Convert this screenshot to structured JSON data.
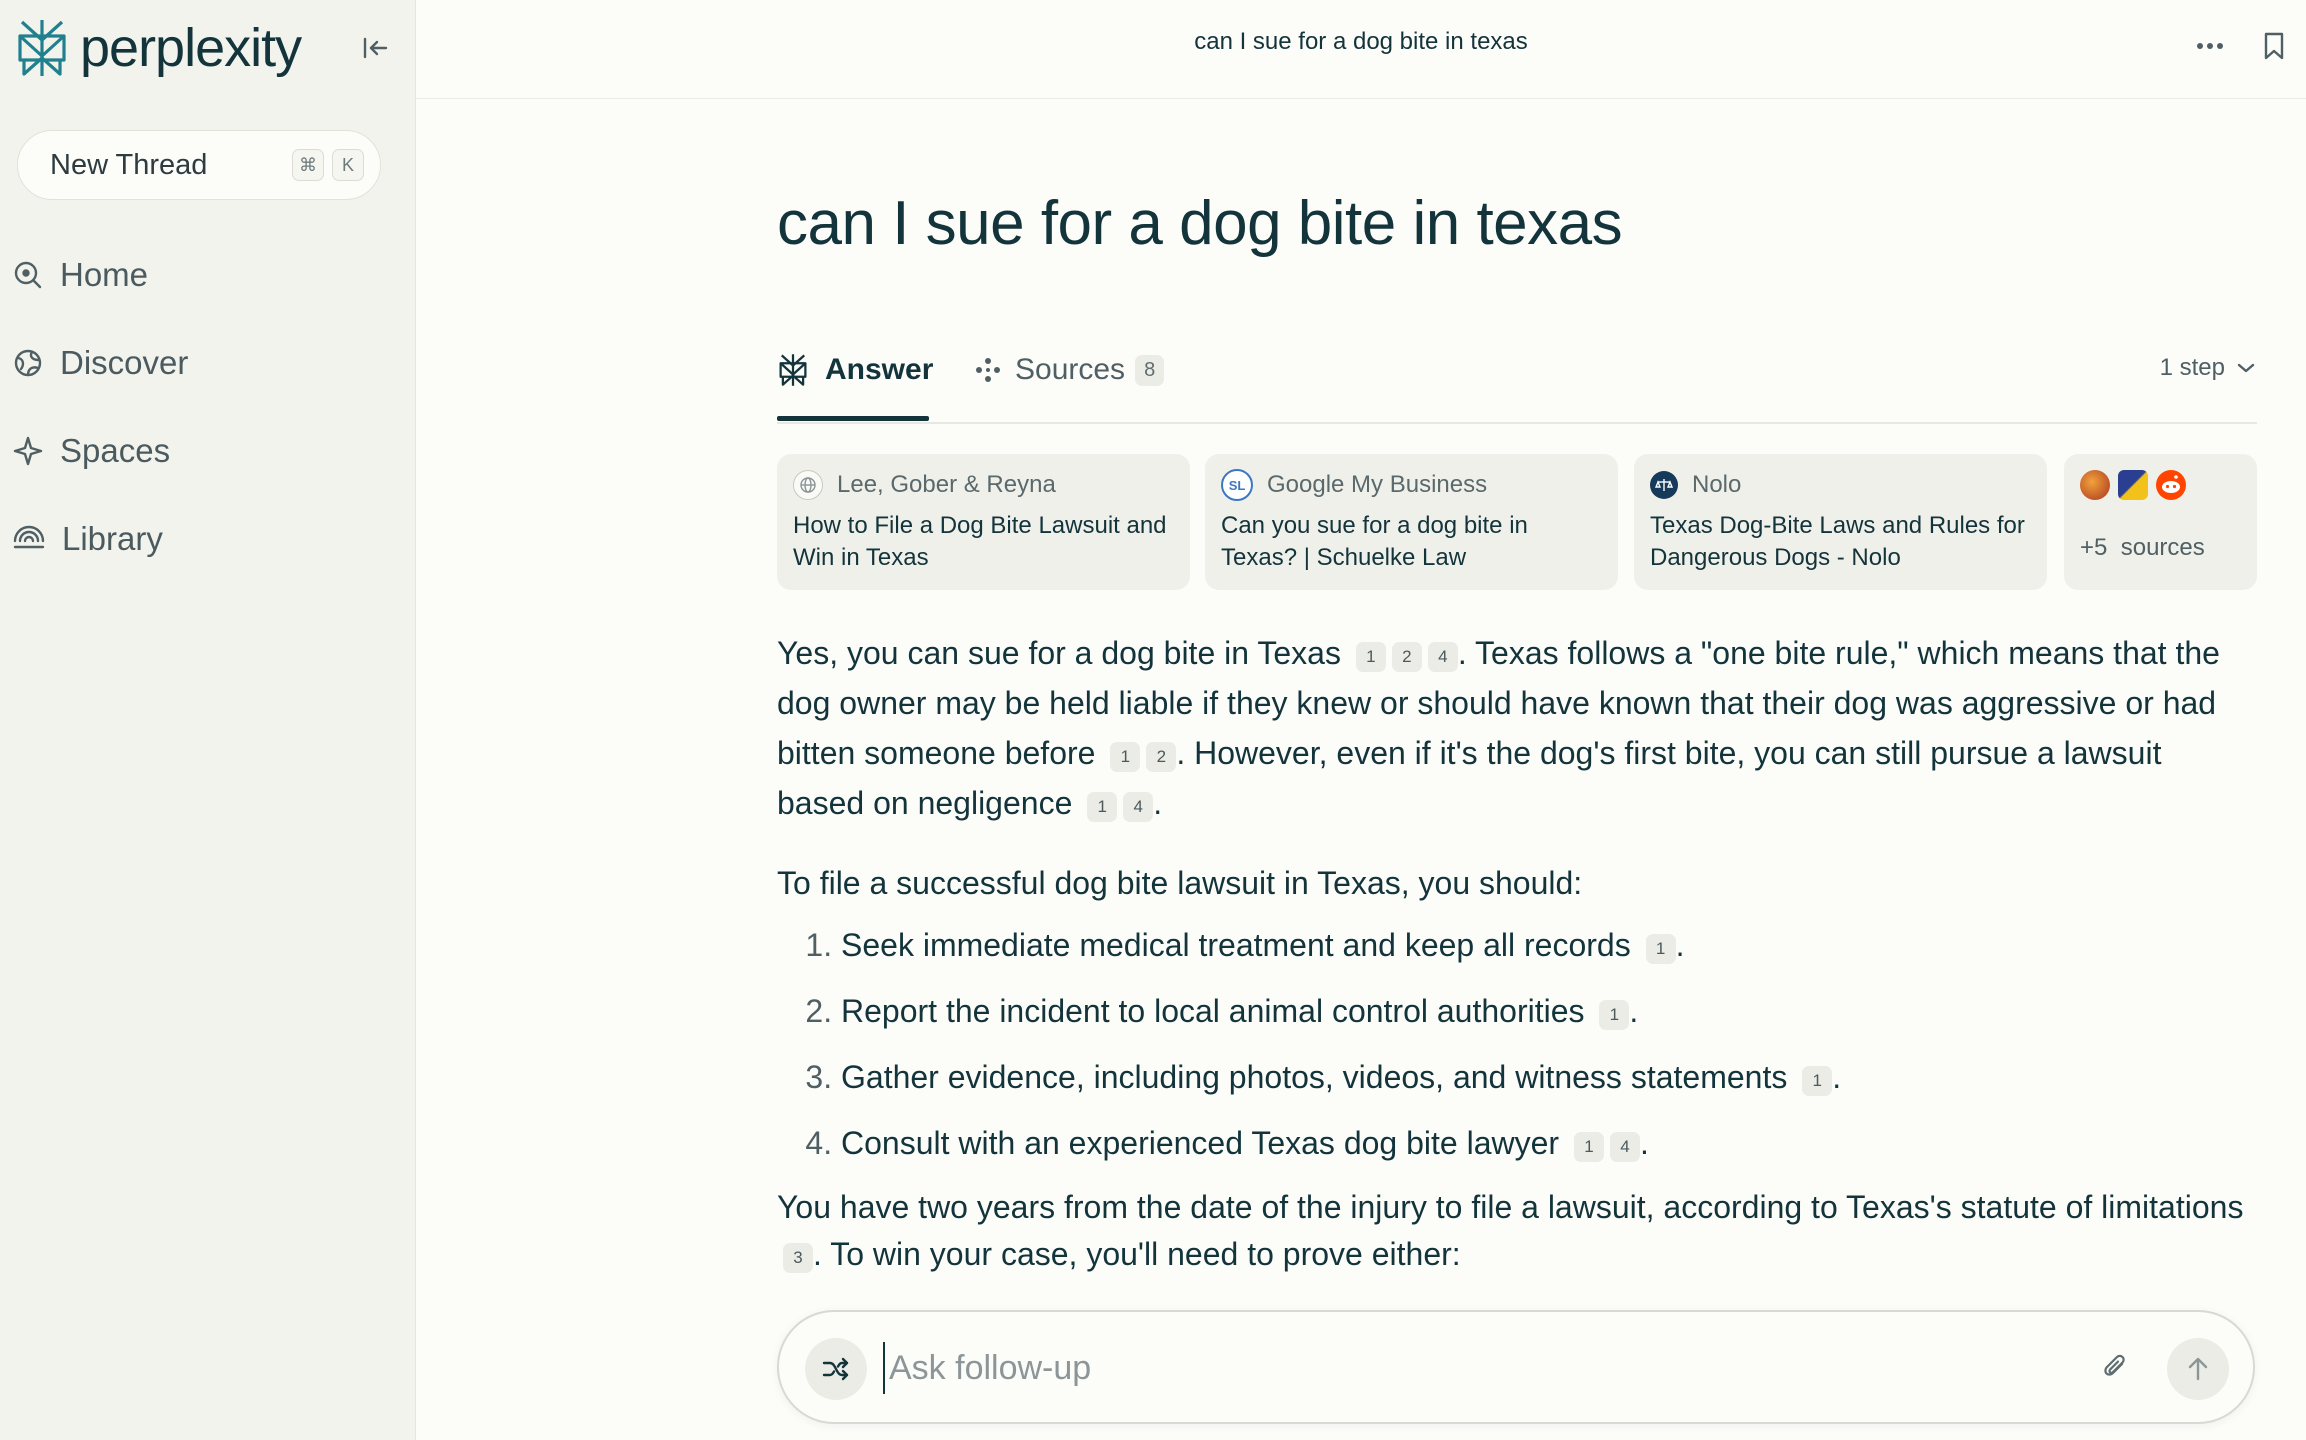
{
  "sidebar": {
    "brand": "perplexity",
    "new_thread_label": "New Thread",
    "shortcut_keys": [
      "⌘",
      "K"
    ],
    "nav": [
      {
        "label": "Home",
        "icon": "home-search-icon"
      },
      {
        "label": "Discover",
        "icon": "globe-icon"
      },
      {
        "label": "Spaces",
        "icon": "sparkle-icon"
      },
      {
        "label": "Library",
        "icon": "library-icon"
      }
    ]
  },
  "header": {
    "thread_title": "can I sue for a dog bite in texas"
  },
  "main": {
    "query": "can I sue for a dog bite in texas",
    "tabs": {
      "answer_label": "Answer",
      "sources_label": "Sources",
      "sources_count": "8",
      "steps_label": "1 step"
    },
    "source_cards": [
      {
        "source": "Lee, Gober & Reyna",
        "title": "How to File a Dog Bite Lawsuit and Win in Texas"
      },
      {
        "source": "Google My Business",
        "title": "Can you sue for a dog bite in Texas? | Schuelke Law"
      },
      {
        "source": "Nolo",
        "title": "Texas Dog-Bite Laws and Rules for Dangerous Dogs - Nolo"
      }
    ],
    "more_sources": {
      "count": "+5",
      "label": "sources"
    },
    "answer": {
      "p1": {
        "s1": "Yes, you can sue for a dog bite in Texas",
        "c1": [
          "1",
          "2",
          "4"
        ],
        "s2": ". Texas follows a \"one bite rule,\" which means that the dog owner may be held liable if they knew or should have known that their dog was aggressive or had bitten someone before",
        "c2": [
          "1",
          "2"
        ],
        "s3": ". However, even if it's the dog's first bite, you can still pursue a lawsuit based on negligence",
        "c3": [
          "1",
          "4"
        ],
        "s4": "."
      },
      "intro2": "To file a successful dog bite lawsuit in Texas, you should:",
      "steps": [
        {
          "text": "Seek immediate medical treatment and keep all records",
          "cites": [
            "1"
          ]
        },
        {
          "text": "Report the incident to local animal control authorities",
          "cites": [
            "1"
          ]
        },
        {
          "text": "Gather evidence, including photos, videos, and witness statements",
          "cites": [
            "1"
          ]
        },
        {
          "text": "Consult with an experienced Texas dog bite lawyer",
          "cites": [
            "1",
            "4"
          ]
        }
      ],
      "closing": {
        "s1": "You have two years from the date of the injury to file a lawsuit, according to Texas's statute of limitations",
        "c1": [
          "3"
        ],
        "s2": ". To win your case, you'll need to prove either:"
      }
    }
  },
  "followup": {
    "placeholder": "Ask follow-up"
  },
  "colors": {
    "accent": "#20808d",
    "text": "#13343b",
    "sidebar_bg": "#f3f3ee",
    "page_bg": "#fcfcf9"
  }
}
